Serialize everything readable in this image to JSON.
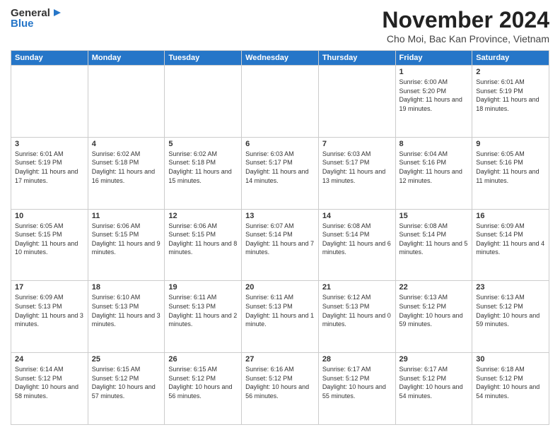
{
  "logo": {
    "general": "General",
    "blue": "Blue"
  },
  "title": "November 2024",
  "location": "Cho Moi, Bac Kan Province, Vietnam",
  "days_of_week": [
    "Sunday",
    "Monday",
    "Tuesday",
    "Wednesday",
    "Thursday",
    "Friday",
    "Saturday"
  ],
  "weeks": [
    [
      {
        "day": "",
        "info": ""
      },
      {
        "day": "",
        "info": ""
      },
      {
        "day": "",
        "info": ""
      },
      {
        "day": "",
        "info": ""
      },
      {
        "day": "",
        "info": ""
      },
      {
        "day": "1",
        "info": "Sunrise: 6:00 AM\nSunset: 5:20 PM\nDaylight: 11 hours and 19 minutes."
      },
      {
        "day": "2",
        "info": "Sunrise: 6:01 AM\nSunset: 5:19 PM\nDaylight: 11 hours and 18 minutes."
      }
    ],
    [
      {
        "day": "3",
        "info": "Sunrise: 6:01 AM\nSunset: 5:19 PM\nDaylight: 11 hours and 17 minutes."
      },
      {
        "day": "4",
        "info": "Sunrise: 6:02 AM\nSunset: 5:18 PM\nDaylight: 11 hours and 16 minutes."
      },
      {
        "day": "5",
        "info": "Sunrise: 6:02 AM\nSunset: 5:18 PM\nDaylight: 11 hours and 15 minutes."
      },
      {
        "day": "6",
        "info": "Sunrise: 6:03 AM\nSunset: 5:17 PM\nDaylight: 11 hours and 14 minutes."
      },
      {
        "day": "7",
        "info": "Sunrise: 6:03 AM\nSunset: 5:17 PM\nDaylight: 11 hours and 13 minutes."
      },
      {
        "day": "8",
        "info": "Sunrise: 6:04 AM\nSunset: 5:16 PM\nDaylight: 11 hours and 12 minutes."
      },
      {
        "day": "9",
        "info": "Sunrise: 6:05 AM\nSunset: 5:16 PM\nDaylight: 11 hours and 11 minutes."
      }
    ],
    [
      {
        "day": "10",
        "info": "Sunrise: 6:05 AM\nSunset: 5:15 PM\nDaylight: 11 hours and 10 minutes."
      },
      {
        "day": "11",
        "info": "Sunrise: 6:06 AM\nSunset: 5:15 PM\nDaylight: 11 hours and 9 minutes."
      },
      {
        "day": "12",
        "info": "Sunrise: 6:06 AM\nSunset: 5:15 PM\nDaylight: 11 hours and 8 minutes."
      },
      {
        "day": "13",
        "info": "Sunrise: 6:07 AM\nSunset: 5:14 PM\nDaylight: 11 hours and 7 minutes."
      },
      {
        "day": "14",
        "info": "Sunrise: 6:08 AM\nSunset: 5:14 PM\nDaylight: 11 hours and 6 minutes."
      },
      {
        "day": "15",
        "info": "Sunrise: 6:08 AM\nSunset: 5:14 PM\nDaylight: 11 hours and 5 minutes."
      },
      {
        "day": "16",
        "info": "Sunrise: 6:09 AM\nSunset: 5:14 PM\nDaylight: 11 hours and 4 minutes."
      }
    ],
    [
      {
        "day": "17",
        "info": "Sunrise: 6:09 AM\nSunset: 5:13 PM\nDaylight: 11 hours and 3 minutes."
      },
      {
        "day": "18",
        "info": "Sunrise: 6:10 AM\nSunset: 5:13 PM\nDaylight: 11 hours and 3 minutes."
      },
      {
        "day": "19",
        "info": "Sunrise: 6:11 AM\nSunset: 5:13 PM\nDaylight: 11 hours and 2 minutes."
      },
      {
        "day": "20",
        "info": "Sunrise: 6:11 AM\nSunset: 5:13 PM\nDaylight: 11 hours and 1 minute."
      },
      {
        "day": "21",
        "info": "Sunrise: 6:12 AM\nSunset: 5:13 PM\nDaylight: 11 hours and 0 minutes."
      },
      {
        "day": "22",
        "info": "Sunrise: 6:13 AM\nSunset: 5:12 PM\nDaylight: 10 hours and 59 minutes."
      },
      {
        "day": "23",
        "info": "Sunrise: 6:13 AM\nSunset: 5:12 PM\nDaylight: 10 hours and 59 minutes."
      }
    ],
    [
      {
        "day": "24",
        "info": "Sunrise: 6:14 AM\nSunset: 5:12 PM\nDaylight: 10 hours and 58 minutes."
      },
      {
        "day": "25",
        "info": "Sunrise: 6:15 AM\nSunset: 5:12 PM\nDaylight: 10 hours and 57 minutes."
      },
      {
        "day": "26",
        "info": "Sunrise: 6:15 AM\nSunset: 5:12 PM\nDaylight: 10 hours and 56 minutes."
      },
      {
        "day": "27",
        "info": "Sunrise: 6:16 AM\nSunset: 5:12 PM\nDaylight: 10 hours and 56 minutes."
      },
      {
        "day": "28",
        "info": "Sunrise: 6:17 AM\nSunset: 5:12 PM\nDaylight: 10 hours and 55 minutes."
      },
      {
        "day": "29",
        "info": "Sunrise: 6:17 AM\nSunset: 5:12 PM\nDaylight: 10 hours and 54 minutes."
      },
      {
        "day": "30",
        "info": "Sunrise: 6:18 AM\nSunset: 5:12 PM\nDaylight: 10 hours and 54 minutes."
      }
    ]
  ]
}
